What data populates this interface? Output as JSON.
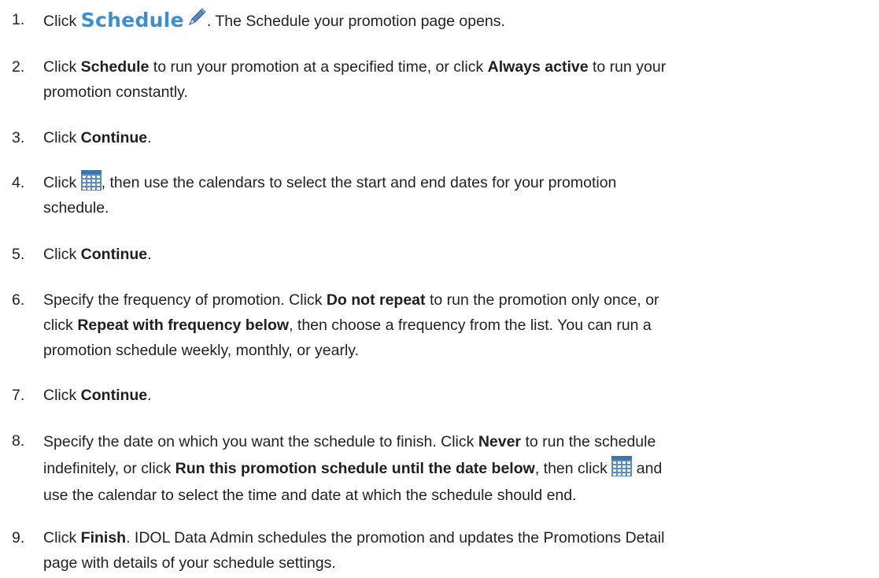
{
  "steps": [
    {
      "number": "1.",
      "click": "Click ",
      "schedule_button_label": "Schedule",
      "pencil_icon": "pencil-icon",
      "text": ". The Schedule your promotion page opens."
    },
    {
      "number": "2.",
      "t1": "Click ",
      "b1": "Schedule",
      "t2": " to run your promotion at a specified time, or click ",
      "b2": "Always active",
      "t3": " to run your",
      "t4": "promotion constantly."
    },
    {
      "number": "3.",
      "t1": "Click ",
      "b1": "Continue",
      "t2": "."
    },
    {
      "number": "4.",
      "t1": "Click ",
      "calendar_icon": "calendar-icon",
      "t2": ", then use the calendars to select the start and end dates for your promotion",
      "t3": "schedule."
    },
    {
      "number": "5.",
      "t1": "Click ",
      "b1": "Continue",
      "t2": "."
    },
    {
      "number": "6.",
      "t1": "Specify the frequency of promotion. Click ",
      "b1": "Do not repeat",
      "t2": " to run the promotion only once, or",
      "t3": "click ",
      "b2": "Repeat with frequency below",
      "t4": ", then choose a frequency from the list. You can run a",
      "t5": "promotion schedule weekly, monthly, or yearly."
    },
    {
      "number": "7.",
      "t1": "Click ",
      "b1": "Continue",
      "t2": "."
    },
    {
      "number": "8.",
      "t1": "Specify the date on which you want the schedule to finish. Click ",
      "b1": "Never",
      "t2": " to run the schedule",
      "t3": "indefinitely, or click ",
      "b2": "Run this promotion schedule until the date below",
      "t4": ", then click ",
      "t5": " and",
      "t6": "use the calendar to select the time and date at which the schedule should end."
    },
    {
      "number": "9.",
      "t1": "Click ",
      "b1": "Finish",
      "t2": ". IDOL Data Admin schedules the promotion and updates the Promotions Detail",
      "t3": "page with details of your schedule settings."
    }
  ],
  "colors": {
    "text": "#222222",
    "schedule_label": "#3b8fd0",
    "calendar_icon": "#5a8ec0"
  }
}
